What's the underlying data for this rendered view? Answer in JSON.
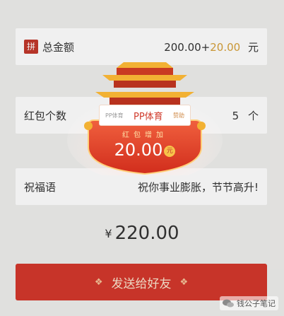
{
  "total_amount_row": {
    "icon_text": "拼",
    "label": "总金额",
    "base": "200.00+",
    "bonus": "20.00",
    "unit": "元"
  },
  "count_row": {
    "label": "红包个数",
    "value": "5",
    "unit": "个"
  },
  "greeting_row": {
    "label": "祝福语",
    "value": "祝你事业膨胀，节节高升!"
  },
  "total": {
    "symbol": "¥",
    "amount": "220.00"
  },
  "send_button": {
    "label": "发送给好友"
  },
  "popup": {
    "pp_logo_text": "PP体育",
    "pp_sponsor": "PP体育",
    "pp_hint": "赞助",
    "headline": "红包增加",
    "amount": "20.00",
    "unit": "元"
  },
  "watermark": {
    "text": "钱公子笔记"
  },
  "colors": {
    "red": "#d4382c",
    "gold": "#d6a13a",
    "popup_red": "#d93a2a"
  }
}
